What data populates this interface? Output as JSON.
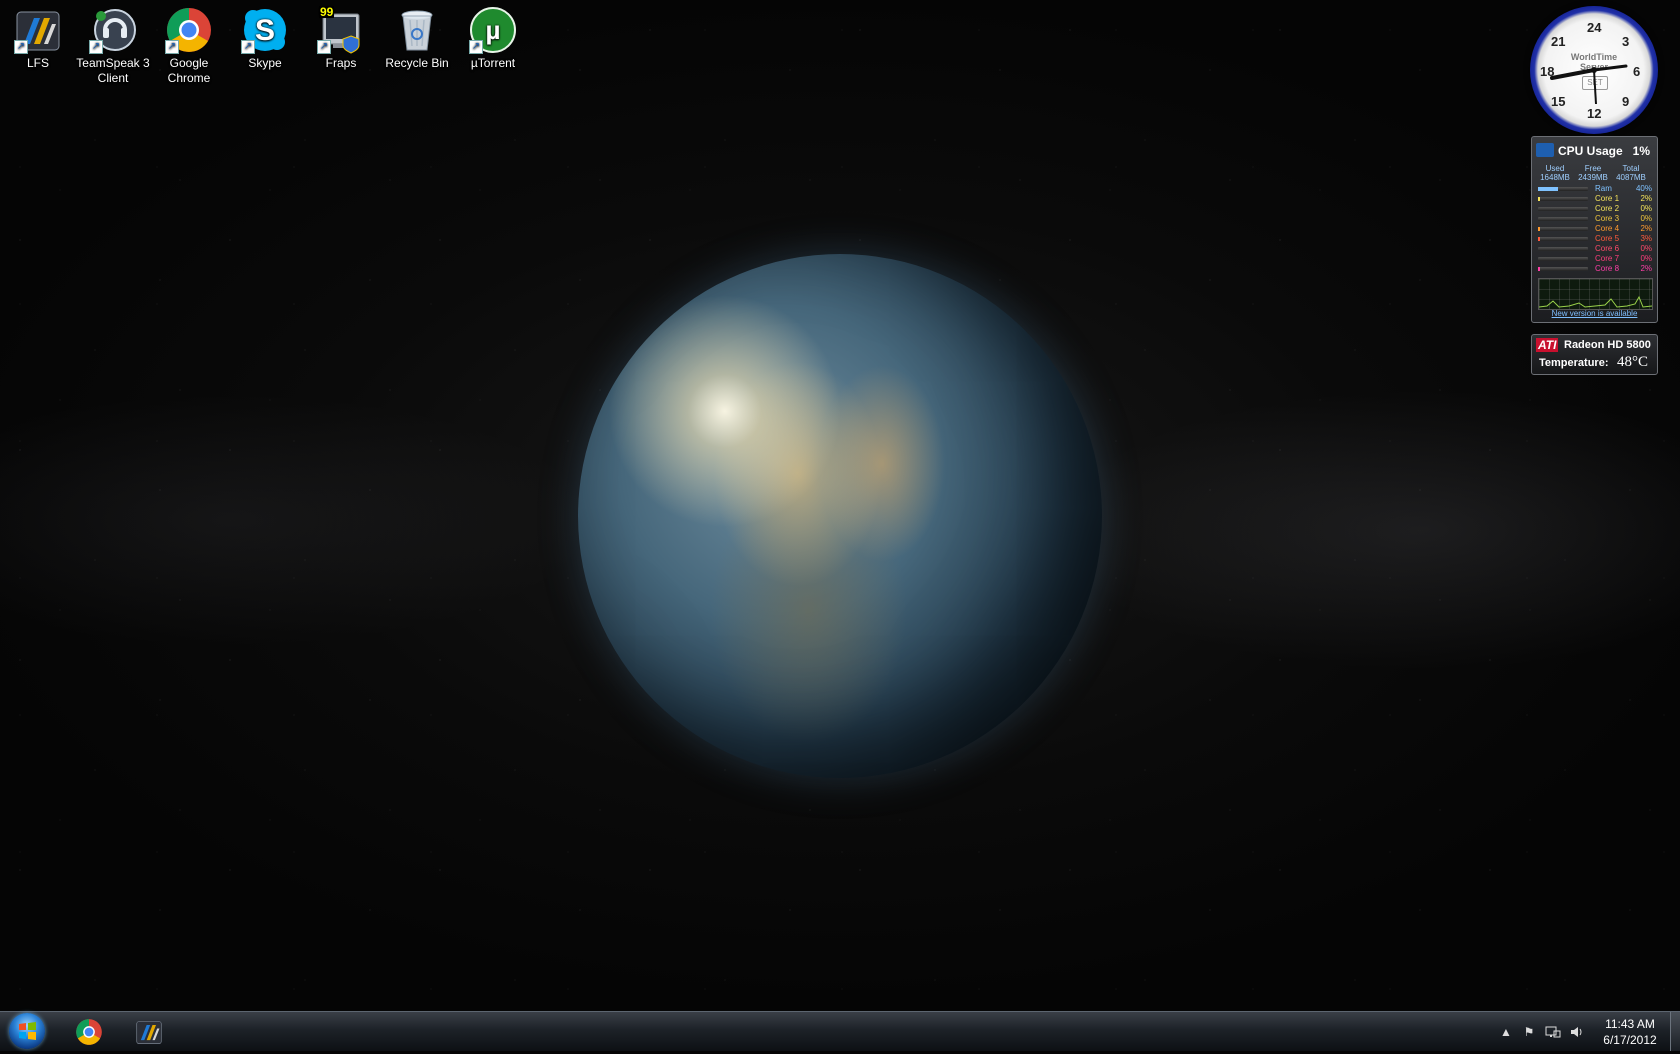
{
  "desktop_icons": [
    {
      "label": "LFS"
    },
    {
      "label": "TeamSpeak 3 Client"
    },
    {
      "label": "Google Chrome"
    },
    {
      "label": "Skype"
    },
    {
      "label": "Fraps",
      "badge": "99"
    },
    {
      "label": "Recycle Bin"
    },
    {
      "label": "µTorrent"
    }
  ],
  "clock_gadget": {
    "brand": "WorldTime Server",
    "face_button": "SET",
    "numbers": [
      "24",
      "3",
      "6",
      "9",
      "12",
      "15",
      "18",
      "21"
    ]
  },
  "cpu_gadget": {
    "title": "CPU Usage",
    "percent": "1%",
    "mem_headers": [
      "Used",
      "Free",
      "Total"
    ],
    "mem_values": [
      "1648MB",
      "2439MB",
      "4087MB"
    ],
    "rows": [
      {
        "name": "Ram",
        "value": "40%",
        "color": "#7fc2ff",
        "level": 0.4
      },
      {
        "name": "Core 1",
        "value": "2%",
        "color": "#f5e35a",
        "level": 0.02
      },
      {
        "name": "Core 2",
        "value": "0%",
        "color": "#f5e35a",
        "level": 0.0
      },
      {
        "name": "Core 3",
        "value": "0%",
        "color": "#f0c53c",
        "level": 0.0
      },
      {
        "name": "Core 4",
        "value": "2%",
        "color": "#ff9a2e",
        "level": 0.02
      },
      {
        "name": "Core 5",
        "value": "3%",
        "color": "#ff5a3c",
        "level": 0.03
      },
      {
        "name": "Core 6",
        "value": "0%",
        "color": "#ff4a6a",
        "level": 0.0
      },
      {
        "name": "Core 7",
        "value": "0%",
        "color": "#ff3e7c",
        "level": 0.0
      },
      {
        "name": "Core 8",
        "value": "2%",
        "color": "#ff3fa6",
        "level": 0.02
      }
    ],
    "update_link": "New version is available"
  },
  "gpu_gadget": {
    "brand": "ATI",
    "model": "Radeon HD 5800",
    "temp_label": "Temperature:",
    "temp_value": "48°C"
  },
  "taskbar": {
    "pinned": [
      "Google Chrome",
      "LFS"
    ],
    "time": "11:43 AM",
    "date": "6/17/2012"
  }
}
